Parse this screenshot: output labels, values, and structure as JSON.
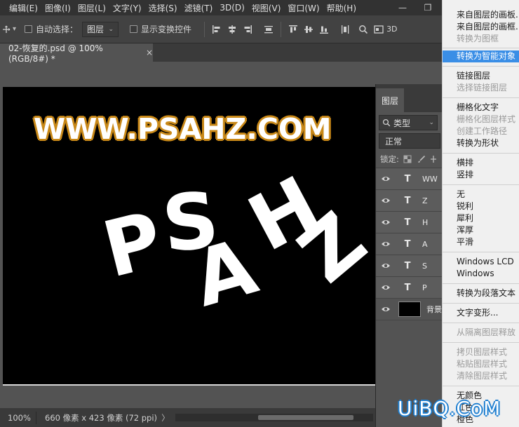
{
  "menubar": {
    "items": [
      "编辑(E)",
      "图像(I)",
      "图层(L)",
      "文字(Y)",
      "选择(S)",
      "滤镜(T)",
      "3D(D)",
      "视图(V)",
      "窗口(W)",
      "帮助(H)"
    ],
    "win_minimize": "—",
    "win_restore": "❐"
  },
  "options": {
    "auto_select_label": "自动选择：",
    "auto_select_target": "图层",
    "show_transform_label": "显示变换控件",
    "mode_3d": "3D"
  },
  "document": {
    "tab_title": "02-恢复的.psd @ 100%(RGB/8#) *",
    "close_glyph": "×"
  },
  "canvas": {
    "url_text": "WWW.PSAHZ.COM",
    "letters": [
      "P",
      "S",
      "A",
      "H",
      "Z"
    ]
  },
  "status": {
    "zoom": "100%",
    "dimensions": "660 像素 x 423 像素 (72 ppi)",
    "nav_right": "〉",
    "nav_left": "〈"
  },
  "layers_panel": {
    "tab": "图层",
    "filter_label": "类型",
    "blend_mode": "正常",
    "lock_label": "锁定:",
    "layers": [
      {
        "type": "T",
        "name": "WW"
      },
      {
        "type": "T",
        "name": "Z"
      },
      {
        "type": "T",
        "name": "H"
      },
      {
        "type": "T",
        "name": "A"
      },
      {
        "type": "T",
        "name": "S"
      },
      {
        "type": "T",
        "name": "P"
      }
    ],
    "background_name": "背景"
  },
  "context_menu": {
    "items": [
      {
        "label": "来自图层的画板...",
        "state": "normal"
      },
      {
        "label": "来自图层的画框...",
        "state": "normal"
      },
      {
        "label": "转换为图框",
        "state": "disabled"
      },
      {
        "label": "-",
        "state": "divider"
      },
      {
        "label": "转换为智能对象",
        "state": "highlight"
      },
      {
        "label": "-",
        "state": "divider"
      },
      {
        "label": "链接图层",
        "state": "normal"
      },
      {
        "label": "选择链接图层",
        "state": "disabled"
      },
      {
        "label": "-",
        "state": "divider"
      },
      {
        "label": "栅格化文字",
        "state": "normal"
      },
      {
        "label": "栅格化图层样式",
        "state": "disabled"
      },
      {
        "label": "创建工作路径",
        "state": "disabled"
      },
      {
        "label": "转换为形状",
        "state": "normal"
      },
      {
        "label": "-",
        "state": "divider"
      },
      {
        "label": "横排",
        "state": "normal"
      },
      {
        "label": "竖排",
        "state": "normal"
      },
      {
        "label": "-",
        "state": "divider"
      },
      {
        "label": "无",
        "state": "normal"
      },
      {
        "label": "锐利",
        "state": "normal"
      },
      {
        "label": "犀利",
        "state": "normal"
      },
      {
        "label": "浑厚",
        "state": "normal"
      },
      {
        "label": "平滑",
        "state": "normal"
      },
      {
        "label": "-",
        "state": "divider"
      },
      {
        "label": "Windows LCD",
        "state": "normal"
      },
      {
        "label": "Windows",
        "state": "normal"
      },
      {
        "label": "-",
        "state": "divider"
      },
      {
        "label": "转换为段落文本",
        "state": "normal"
      },
      {
        "label": "-",
        "state": "divider"
      },
      {
        "label": "文字变形...",
        "state": "normal"
      },
      {
        "label": "-",
        "state": "divider"
      },
      {
        "label": "从隔离图层释放",
        "state": "disabled"
      },
      {
        "label": "-",
        "state": "divider"
      },
      {
        "label": "拷贝图层样式",
        "state": "disabled"
      },
      {
        "label": "粘贴图层样式",
        "state": "disabled"
      },
      {
        "label": "清除图层样式",
        "state": "disabled"
      },
      {
        "label": "-",
        "state": "divider"
      },
      {
        "label": "无颜色",
        "state": "normal"
      },
      {
        "label": "红色",
        "state": "normal"
      },
      {
        "label": "橙色",
        "state": "normal"
      }
    ]
  },
  "watermark": "UiBQ.CoM",
  "colors": {
    "accent_highlight": "#3a8ee6",
    "url_outline": "#c98918",
    "watermark_outline": "#1f7fd0"
  }
}
